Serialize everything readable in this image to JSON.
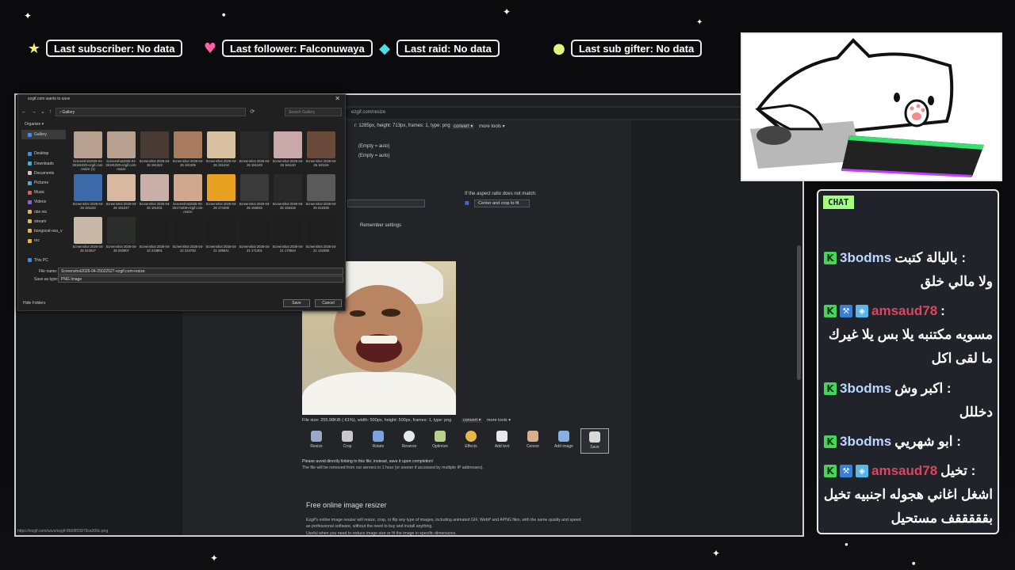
{
  "alerts": [
    {
      "icon": "star-icon",
      "color": "#f4f17a",
      "glyph": "★",
      "text": "Last subscriber: No data"
    },
    {
      "icon": "heart-icon",
      "color": "#ff5fa8",
      "glyph": "♥",
      "text": "Last follower: Falconuwaya"
    },
    {
      "icon": "diamond-icon",
      "color": "#4ee0e0",
      "glyph": "◆",
      "text": "Last raid: No data"
    },
    {
      "icon": "coin-icon",
      "color": "#e6f27a",
      "glyph": "●",
      "text": "Last sub gifter: No data"
    }
  ],
  "browser": {
    "url": "ezgif.com/resize",
    "status_url": "https://ezgif.com/save/ezgif-8b58f03979ca306c.png"
  },
  "page": {
    "file_info_top": "r: 1285px, height: 713px, frames: 1, type: png",
    "convert": "convert ▾",
    "more_tools": "more tools ▾",
    "empty1": "(Empty = auto)",
    "empty2": "(Empty = auto)",
    "aspect_label": "If the aspect ratio does not match:",
    "aspect_value": "Center and crop to fit",
    "remember": "Remember settings",
    "file_info": "File size: 255.98KiB (-61%), width: 500px, height: 500px, frames: 1, type: png",
    "convert2": "convert ▾",
    "more_tools2": "more tools ▾",
    "tools": [
      "Resize",
      "Crop",
      "Rotate",
      "Reverse",
      "Optimize",
      "Effects",
      "Add text",
      "Censor",
      "Add image",
      "Save"
    ],
    "avoid": "Please avoid directly linking to this file; instead, save it upon completion!",
    "removed": "The file will be removed from our servers in 1 hour (or sooner if accessed by multiple IP addresses).",
    "free_title": "Free online image resizer",
    "desc1": "Ezgif's online image resizer will resize, crop, or flip any type of images, including animated GIF, WebP and APNG files, with the same quality and speed",
    "desc2": "as professional software, without the need to buy and install anything.",
    "desc3": "Useful when you need to reduce image size or fit the image in specific dimensions."
  },
  "dialog": {
    "title": "ezgif.com wants to save",
    "path": "›  Gallery",
    "search": "Search Gallery",
    "organize": "Organize ▾",
    "sidebar": [
      "Gallery",
      "",
      "Desktop",
      "Downloads",
      "Documents",
      "Pictures",
      "Music",
      "Videos",
      "obs rec",
      "stream",
      "bongocat-osu_v",
      "rec",
      "",
      "This PC"
    ],
    "files": [
      "Screenshot2026-04-26181020-ezgif.com-resize (1)",
      "Screenshot2026-04-26181020-ezgif.com-resize",
      "Screenshot 2026-04-26 181323",
      "Screenshot 2026-04-26 181305",
      "Screenshot 2026-04-26 181234",
      "Screenshot 2026-04-26 181249",
      "Screenshot 2026-04-26 181120",
      "Screenshot 2026-04-26 181116",
      "Screenshot 2026-04-26 181103",
      "Screenshot 2026-04-26 181047",
      "Screenshot 2026-04-26 181031",
      "Screenshot2026-04-26174408-ezgif.com-resize",
      "Screenshot 2026-04-26 174408",
      "Screenshot 2026-04-25 155915",
      "Screenshot 2026-04-25 155418",
      "Screenshot 2026-04-25 022338",
      "Screenshot 2026-04-25 022527",
      "Screenshot 2026-04-25 020907",
      "Screenshot 2026-04-22 234801",
      "Screenshot 2026-04-22 224750",
      "Screenshot 2026-04-21 185541",
      "Screenshot 2026-04-21 171301",
      "Screenshot 2026-04-21 170944",
      "Screenshot 2026-04-21 132258"
    ],
    "file_name_label": "File name:",
    "file_name": "Screenshot2026-04-25022527-ezgif.com-resize",
    "type_label": "Save as type:",
    "type": "PNG Image",
    "hide_folders": "Hide Folders",
    "save": "Save",
    "cancel": "Cancel"
  },
  "chat": {
    "label": "CHAT",
    "messages": [
      {
        "user": "3bodms",
        "text1": "باليالة كتبت :",
        "text2": "ولا مالي خلق"
      },
      {
        "user": "amsaud78",
        "text1": ":",
        "text2": "مسويه مكتنبه يلا بس يلا غيرك",
        "text3": "ما لقى اكل"
      },
      {
        "user": "3bodms",
        "text1": "اكبر وش :",
        "text2": "دخللل"
      },
      {
        "user": "3bodms",
        "text1": "ابو شهريي :"
      },
      {
        "user": "amsaud78",
        "text1": "تخيل :",
        "text2": "اشغل اغاني هجوله اجنبيه تخيل",
        "text3": "بقققققف مستحيل"
      }
    ]
  }
}
